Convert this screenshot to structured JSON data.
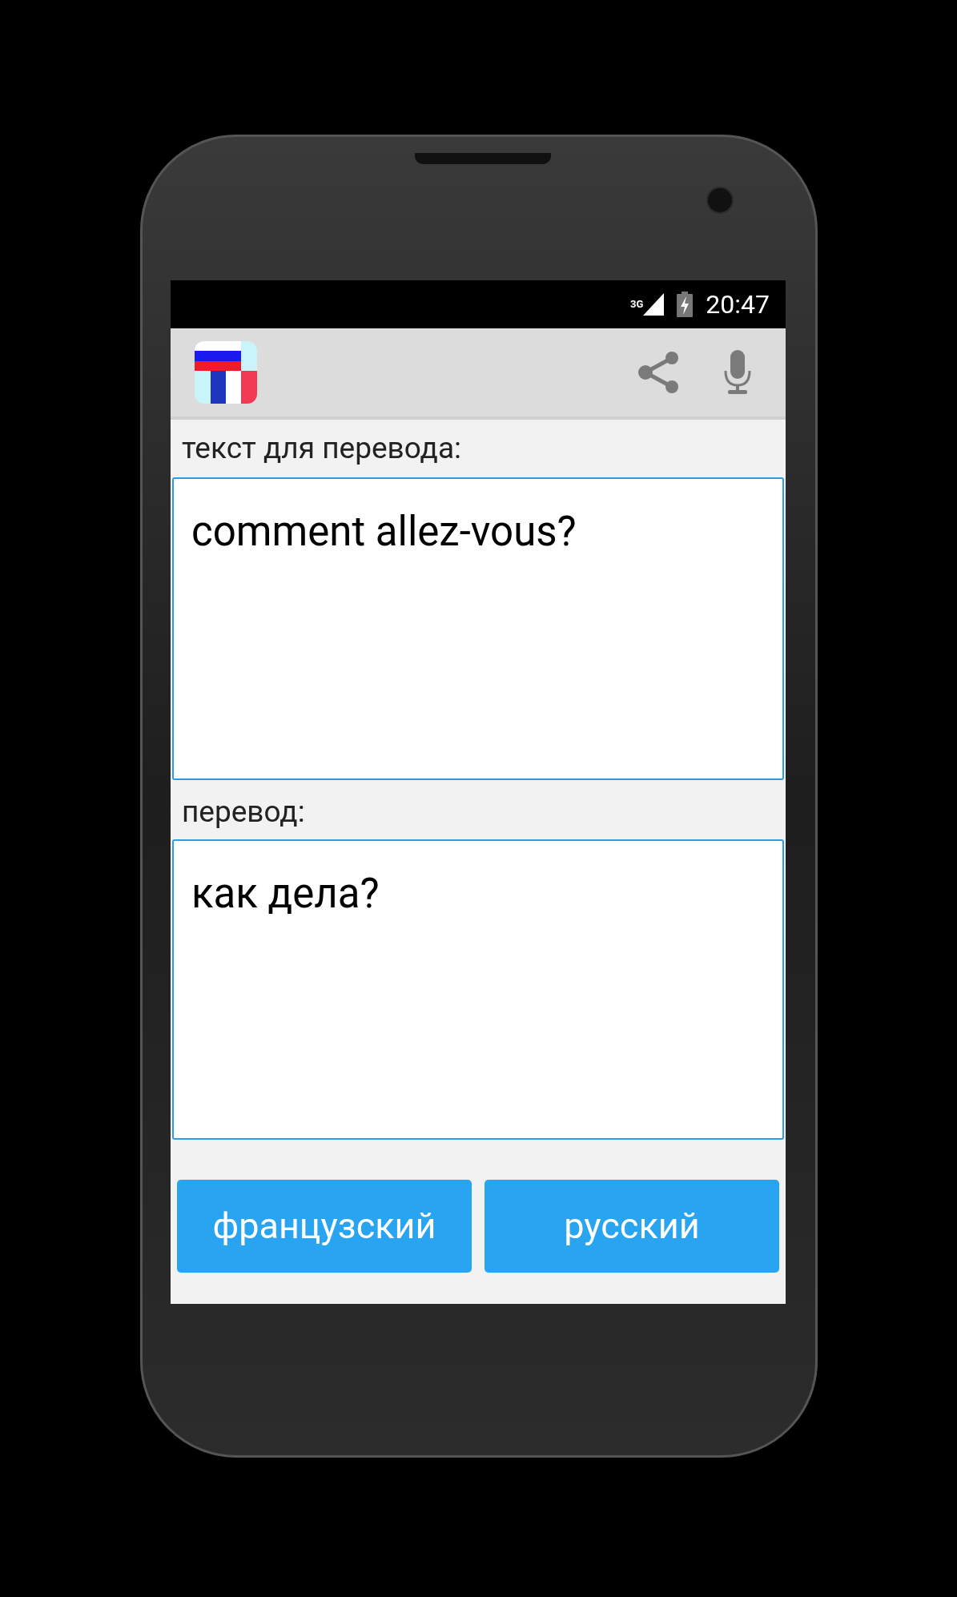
{
  "status_bar": {
    "network": "3G",
    "time": "20:47"
  },
  "source": {
    "label": "текст для перевода:",
    "value": "comment allez-vous?"
  },
  "translation": {
    "label": "перевод:",
    "value": "как дела?"
  },
  "language_buttons": [
    "французский",
    "русский"
  ]
}
